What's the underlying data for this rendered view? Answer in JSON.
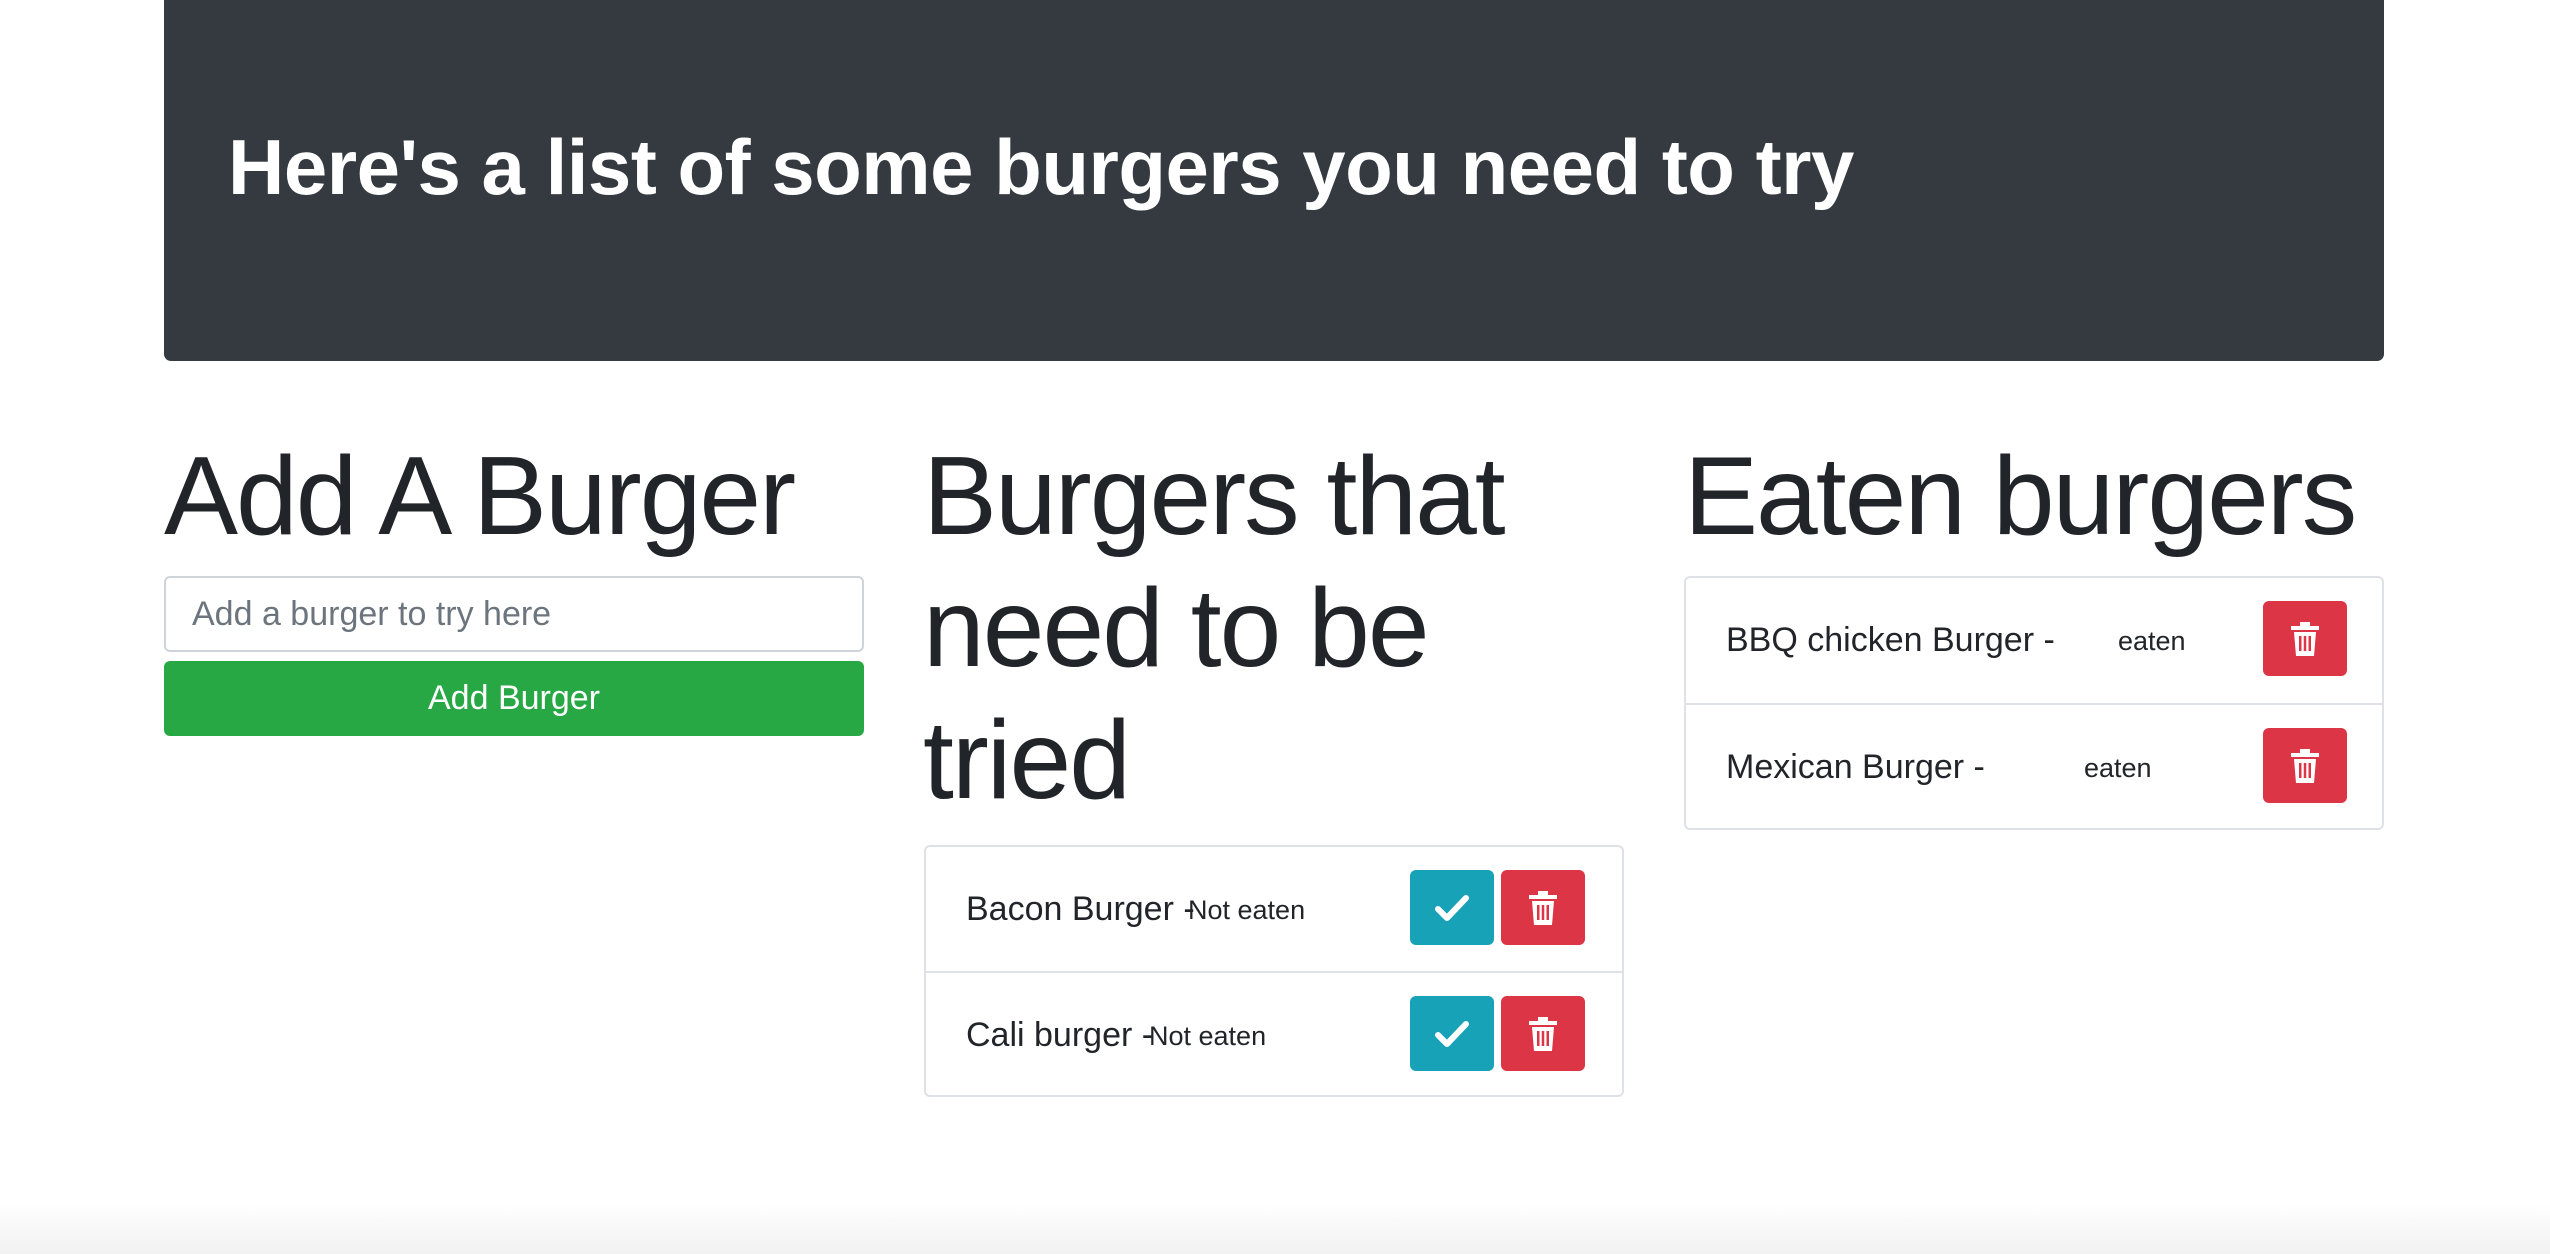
{
  "header": {
    "title": "Here's a list of some burgers you need to try"
  },
  "add_section": {
    "heading": "Add A Burger",
    "input_placeholder": "Add a burger to try here",
    "input_value": "",
    "button_label": "Add Burger"
  },
  "to_try_section": {
    "heading": "Burgers that need to be tried",
    "items": [
      {
        "name": "Bacon Burger -",
        "status": "Not eaten"
      },
      {
        "name": "Cali burger -",
        "status": "Not eaten"
      }
    ]
  },
  "eaten_section": {
    "heading": "Eaten burgers",
    "items": [
      {
        "name": "BBQ chicken Burger -",
        "status": "eaten"
      },
      {
        "name": "Mexican Burger -",
        "status": "eaten"
      }
    ]
  },
  "icons": {
    "devour": "check-icon",
    "delete": "trash-icon"
  },
  "colors": {
    "header_bg": "#343a40",
    "add_button": "#28a745",
    "devour_button": "#17a2b8",
    "delete_button": "#dc3545"
  }
}
